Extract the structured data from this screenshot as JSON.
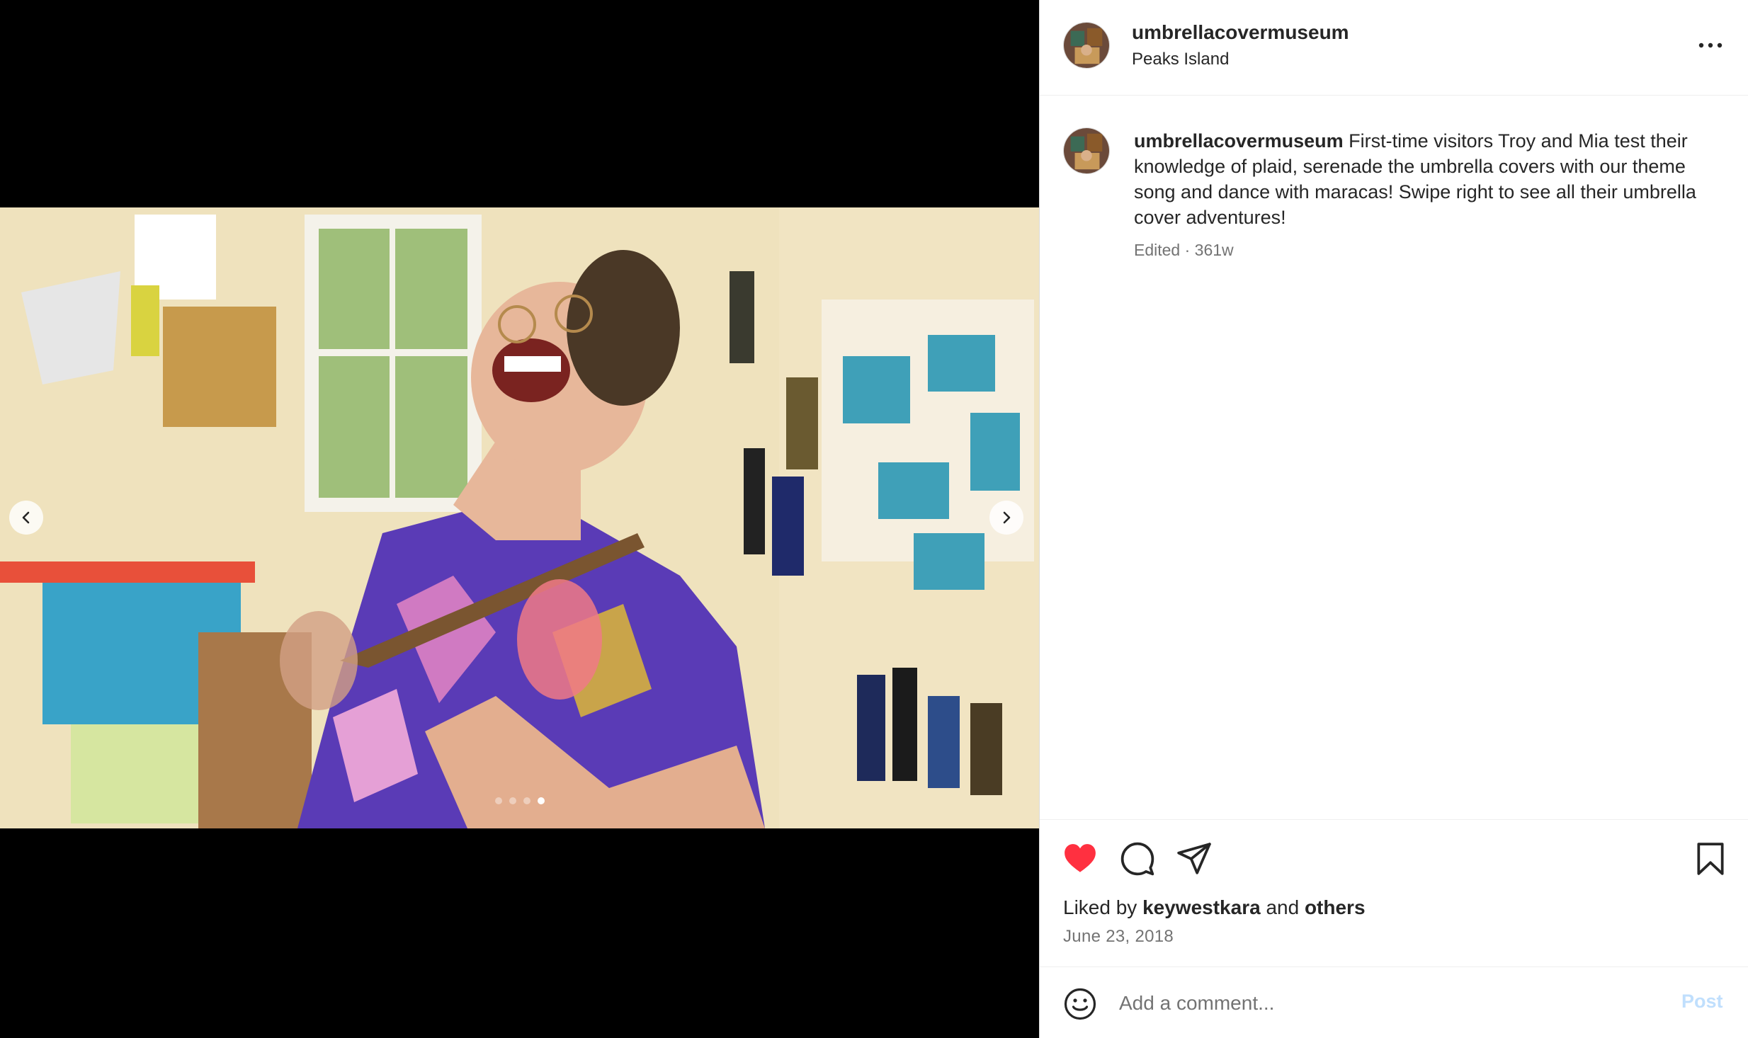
{
  "post": {
    "username": "umbrellacovermuseum",
    "location": "Peaks Island",
    "caption": "First-time visitors Troy and Mia test their knowledge of plaid, serenade the umbrella covers with our theme song and dance with maracas! Swipe right to see all their umbrella cover adventures!",
    "edited_label": "Edited",
    "age": "361w",
    "liked_by_prefix": "Liked by",
    "liked_by_user": "keywestkara",
    "liked_by_and": "and",
    "liked_by_others": "others",
    "date": "June 23, 2018"
  },
  "carousel": {
    "slide_count": 4,
    "active_slide": 4
  },
  "comment_bar": {
    "placeholder": "Add a comment...",
    "post_label": "Post"
  },
  "icons": {
    "like": "heart-icon",
    "comment": "speech-bubble-icon",
    "share": "paper-plane-icon",
    "save": "bookmark-icon",
    "more": "more-options-icon",
    "emoji": "smiley-icon",
    "prev": "chevron-left-icon",
    "next": "chevron-right-icon"
  },
  "colors": {
    "like_active": "#ff3040",
    "post_disabled": "#c0dffd",
    "secondary_text": "#737373"
  }
}
